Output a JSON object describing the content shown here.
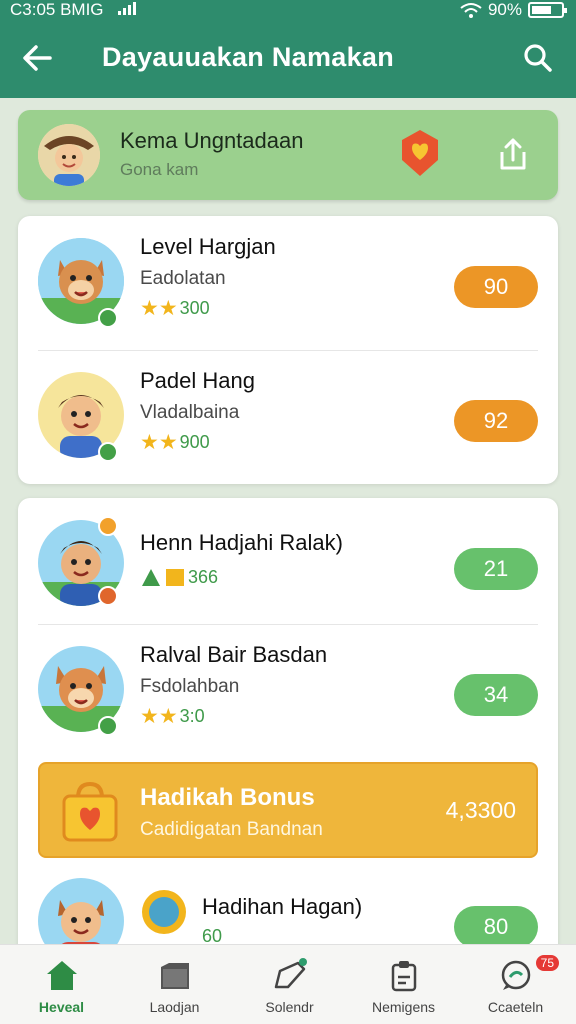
{
  "status_bar": {
    "time": "C3:05 BMIG",
    "battery": "90%"
  },
  "header": {
    "title": "Dayauuakan Namakan"
  },
  "profile": {
    "name": "Kema Ungntadaan",
    "subtitle": "Gona kam"
  },
  "list_top": [
    {
      "title": "Level Hargjan",
      "subtitle": "Eadolatan",
      "stars": "★★",
      "rating": "300",
      "score": "90",
      "score_color": "#ec9626"
    },
    {
      "title": "Padel Hang",
      "subtitle": "Vladalbaina",
      "stars": "★★",
      "rating": "900",
      "score": "92",
      "score_color": "#ec9626"
    }
  ],
  "list_bottom": [
    {
      "title": "Henn Hadjahi Ralak)",
      "subtitle": "",
      "stars": "",
      "rating": "366",
      "score": "21",
      "score_color": "#67c16c"
    },
    {
      "title": "Ralval Bair Basdan",
      "subtitle": "Fsdolahban",
      "stars": "★★",
      "rating": "3:0",
      "score": "34",
      "score_color": "#67c16c"
    }
  ],
  "bonus": {
    "title": "Hadikah Bonus",
    "subtitle": "Cadidigatan Bandnan",
    "value": "4,3300"
  },
  "last_item": {
    "title": "Hadihan Hagan)",
    "rating": "60",
    "score": "80"
  },
  "tabs": [
    {
      "label": "Heveal",
      "icon": "home-icon",
      "active": true
    },
    {
      "label": "Laodjan",
      "icon": "folder-icon",
      "active": false
    },
    {
      "label": "Solendr",
      "icon": "edit-icon",
      "active": false
    },
    {
      "label": "Nemigens",
      "icon": "clipboard-icon",
      "active": false
    },
    {
      "label": "Ccaeteln",
      "icon": "chat-icon",
      "active": false,
      "badge": "75"
    }
  ],
  "colors": {
    "header": "#2e8c6d",
    "banner": "#9bd08e",
    "orange_score": "#ec9626",
    "green_score": "#67c16c",
    "bonus": "#efb63b"
  }
}
